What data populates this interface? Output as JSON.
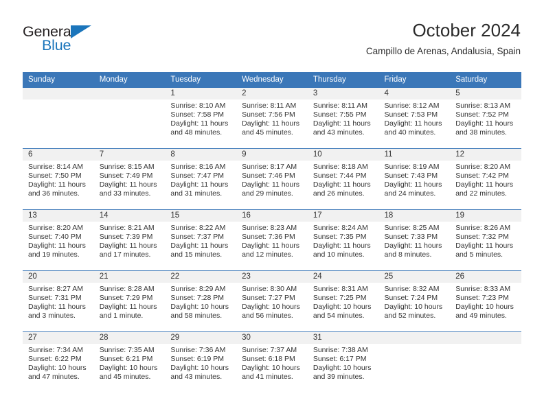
{
  "brand": {
    "word_one": "General",
    "word_two": "Blue",
    "triangle_icon": "triangle-icon",
    "colors": {
      "blue": "#1b75bb",
      "dark": "#231f20"
    }
  },
  "header": {
    "title": "October 2024",
    "subtitle": "Campillo de Arenas, Andalusia, Spain"
  },
  "theme": {
    "header_bg": "#3b77b8",
    "daynum_bg": "#f1f1f1",
    "rule": "#3b77b8",
    "text": "#333333"
  },
  "calendar": {
    "weekday_headers": [
      "Sunday",
      "Monday",
      "Tuesday",
      "Wednesday",
      "Thursday",
      "Friday",
      "Saturday"
    ],
    "weeks": [
      [
        {
          "day": "",
          "empty": true,
          "sunrise": "",
          "sunset": "",
          "daylight_line1": "",
          "daylight_line2": ""
        },
        {
          "day": "",
          "empty": true,
          "sunrise": "",
          "sunset": "",
          "daylight_line1": "",
          "daylight_line2": ""
        },
        {
          "day": "1",
          "sunrise": "Sunrise: 8:10 AM",
          "sunset": "Sunset: 7:58 PM",
          "daylight_line1": "Daylight: 11 hours",
          "daylight_line2": "and 48 minutes."
        },
        {
          "day": "2",
          "sunrise": "Sunrise: 8:11 AM",
          "sunset": "Sunset: 7:56 PM",
          "daylight_line1": "Daylight: 11 hours",
          "daylight_line2": "and 45 minutes."
        },
        {
          "day": "3",
          "sunrise": "Sunrise: 8:11 AM",
          "sunset": "Sunset: 7:55 PM",
          "daylight_line1": "Daylight: 11 hours",
          "daylight_line2": "and 43 minutes."
        },
        {
          "day": "4",
          "sunrise": "Sunrise: 8:12 AM",
          "sunset": "Sunset: 7:53 PM",
          "daylight_line1": "Daylight: 11 hours",
          "daylight_line2": "and 40 minutes."
        },
        {
          "day": "5",
          "sunrise": "Sunrise: 8:13 AM",
          "sunset": "Sunset: 7:52 PM",
          "daylight_line1": "Daylight: 11 hours",
          "daylight_line2": "and 38 minutes."
        }
      ],
      [
        {
          "day": "6",
          "sunrise": "Sunrise: 8:14 AM",
          "sunset": "Sunset: 7:50 PM",
          "daylight_line1": "Daylight: 11 hours",
          "daylight_line2": "and 36 minutes."
        },
        {
          "day": "7",
          "sunrise": "Sunrise: 8:15 AM",
          "sunset": "Sunset: 7:49 PM",
          "daylight_line1": "Daylight: 11 hours",
          "daylight_line2": "and 33 minutes."
        },
        {
          "day": "8",
          "sunrise": "Sunrise: 8:16 AM",
          "sunset": "Sunset: 7:47 PM",
          "daylight_line1": "Daylight: 11 hours",
          "daylight_line2": "and 31 minutes."
        },
        {
          "day": "9",
          "sunrise": "Sunrise: 8:17 AM",
          "sunset": "Sunset: 7:46 PM",
          "daylight_line1": "Daylight: 11 hours",
          "daylight_line2": "and 29 minutes."
        },
        {
          "day": "10",
          "sunrise": "Sunrise: 8:18 AM",
          "sunset": "Sunset: 7:44 PM",
          "daylight_line1": "Daylight: 11 hours",
          "daylight_line2": "and 26 minutes."
        },
        {
          "day": "11",
          "sunrise": "Sunrise: 8:19 AM",
          "sunset": "Sunset: 7:43 PM",
          "daylight_line1": "Daylight: 11 hours",
          "daylight_line2": "and 24 minutes."
        },
        {
          "day": "12",
          "sunrise": "Sunrise: 8:20 AM",
          "sunset": "Sunset: 7:42 PM",
          "daylight_line1": "Daylight: 11 hours",
          "daylight_line2": "and 22 minutes."
        }
      ],
      [
        {
          "day": "13",
          "sunrise": "Sunrise: 8:20 AM",
          "sunset": "Sunset: 7:40 PM",
          "daylight_line1": "Daylight: 11 hours",
          "daylight_line2": "and 19 minutes."
        },
        {
          "day": "14",
          "sunrise": "Sunrise: 8:21 AM",
          "sunset": "Sunset: 7:39 PM",
          "daylight_line1": "Daylight: 11 hours",
          "daylight_line2": "and 17 minutes."
        },
        {
          "day": "15",
          "sunrise": "Sunrise: 8:22 AM",
          "sunset": "Sunset: 7:37 PM",
          "daylight_line1": "Daylight: 11 hours",
          "daylight_line2": "and 15 minutes."
        },
        {
          "day": "16",
          "sunrise": "Sunrise: 8:23 AM",
          "sunset": "Sunset: 7:36 PM",
          "daylight_line1": "Daylight: 11 hours",
          "daylight_line2": "and 12 minutes."
        },
        {
          "day": "17",
          "sunrise": "Sunrise: 8:24 AM",
          "sunset": "Sunset: 7:35 PM",
          "daylight_line1": "Daylight: 11 hours",
          "daylight_line2": "and 10 minutes."
        },
        {
          "day": "18",
          "sunrise": "Sunrise: 8:25 AM",
          "sunset": "Sunset: 7:33 PM",
          "daylight_line1": "Daylight: 11 hours",
          "daylight_line2": "and 8 minutes."
        },
        {
          "day": "19",
          "sunrise": "Sunrise: 8:26 AM",
          "sunset": "Sunset: 7:32 PM",
          "daylight_line1": "Daylight: 11 hours",
          "daylight_line2": "and 5 minutes."
        }
      ],
      [
        {
          "day": "20",
          "sunrise": "Sunrise: 8:27 AM",
          "sunset": "Sunset: 7:31 PM",
          "daylight_line1": "Daylight: 11 hours",
          "daylight_line2": "and 3 minutes."
        },
        {
          "day": "21",
          "sunrise": "Sunrise: 8:28 AM",
          "sunset": "Sunset: 7:29 PM",
          "daylight_line1": "Daylight: 11 hours",
          "daylight_line2": "and 1 minute."
        },
        {
          "day": "22",
          "sunrise": "Sunrise: 8:29 AM",
          "sunset": "Sunset: 7:28 PM",
          "daylight_line1": "Daylight: 10 hours",
          "daylight_line2": "and 58 minutes."
        },
        {
          "day": "23",
          "sunrise": "Sunrise: 8:30 AM",
          "sunset": "Sunset: 7:27 PM",
          "daylight_line1": "Daylight: 10 hours",
          "daylight_line2": "and 56 minutes."
        },
        {
          "day": "24",
          "sunrise": "Sunrise: 8:31 AM",
          "sunset": "Sunset: 7:25 PM",
          "daylight_line1": "Daylight: 10 hours",
          "daylight_line2": "and 54 minutes."
        },
        {
          "day": "25",
          "sunrise": "Sunrise: 8:32 AM",
          "sunset": "Sunset: 7:24 PM",
          "daylight_line1": "Daylight: 10 hours",
          "daylight_line2": "and 52 minutes."
        },
        {
          "day": "26",
          "sunrise": "Sunrise: 8:33 AM",
          "sunset": "Sunset: 7:23 PM",
          "daylight_line1": "Daylight: 10 hours",
          "daylight_line2": "and 49 minutes."
        }
      ],
      [
        {
          "day": "27",
          "sunrise": "Sunrise: 7:34 AM",
          "sunset": "Sunset: 6:22 PM",
          "daylight_line1": "Daylight: 10 hours",
          "daylight_line2": "and 47 minutes."
        },
        {
          "day": "28",
          "sunrise": "Sunrise: 7:35 AM",
          "sunset": "Sunset: 6:21 PM",
          "daylight_line1": "Daylight: 10 hours",
          "daylight_line2": "and 45 minutes."
        },
        {
          "day": "29",
          "sunrise": "Sunrise: 7:36 AM",
          "sunset": "Sunset: 6:19 PM",
          "daylight_line1": "Daylight: 10 hours",
          "daylight_line2": "and 43 minutes."
        },
        {
          "day": "30",
          "sunrise": "Sunrise: 7:37 AM",
          "sunset": "Sunset: 6:18 PM",
          "daylight_line1": "Daylight: 10 hours",
          "daylight_line2": "and 41 minutes."
        },
        {
          "day": "31",
          "sunrise": "Sunrise: 7:38 AM",
          "sunset": "Sunset: 6:17 PM",
          "daylight_line1": "Daylight: 10 hours",
          "daylight_line2": "and 39 minutes."
        },
        {
          "day": "",
          "empty": true,
          "sunrise": "",
          "sunset": "",
          "daylight_line1": "",
          "daylight_line2": ""
        },
        {
          "day": "",
          "empty": true,
          "sunrise": "",
          "sunset": "",
          "daylight_line1": "",
          "daylight_line2": ""
        }
      ]
    ]
  }
}
